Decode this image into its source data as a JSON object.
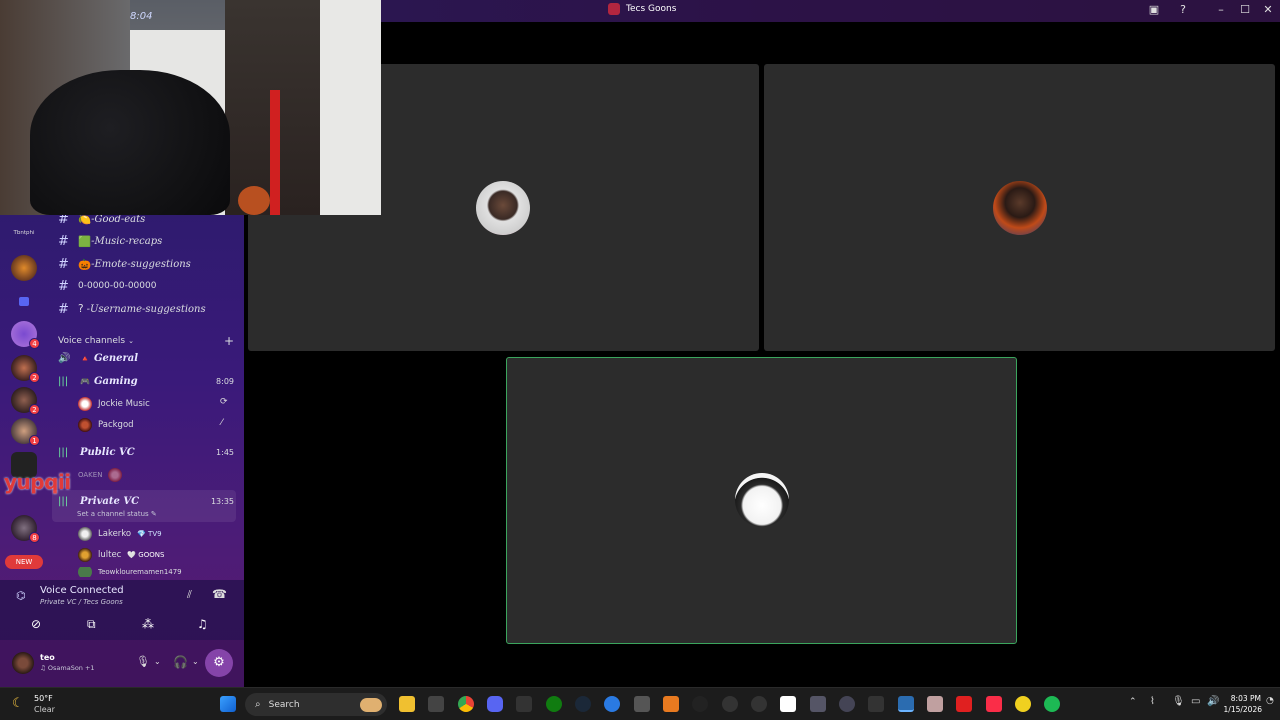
{
  "window": {
    "title": "Tecs Goons",
    "controls": {
      "minimize": "–",
      "maximize": "☐",
      "close": "✕"
    }
  },
  "webcam": {
    "clock_text": "8:04"
  },
  "server_rail": {
    "top_label": "Tbntphi",
    "badges": [
      "4",
      "2",
      "2",
      "1",
      "8"
    ],
    "promo_text": "yupqii",
    "new_badge": "NEW"
  },
  "text_channels": [
    {
      "emoji": "🍋",
      "name": "-Good-eats"
    },
    {
      "emoji": "🟩",
      "name": "-Music-recaps"
    },
    {
      "emoji": "🎃",
      "name": "-Emote-suggestions"
    },
    {
      "emoji": "",
      "name": "0-0000-00-00000"
    },
    {
      "emoji": "?",
      "name": "-Username-suggestions"
    }
  ],
  "voice_section": {
    "header": "Voice channels",
    "add": "+"
  },
  "voice_channels": [
    {
      "icon": "🔊",
      "emoji": "🔺",
      "name": "General",
      "time": ""
    },
    {
      "icon": "|||",
      "emoji": "🎮",
      "name": "Gaming",
      "time": "8:09"
    },
    {
      "icon": "|||",
      "emoji": "",
      "name": "Public VC",
      "time": "1:45"
    },
    {
      "icon": "|||",
      "emoji": "",
      "name": "Private VC",
      "time": "13:35",
      "status": "Set a channel status ✎"
    }
  ],
  "members": {
    "gaming": [
      {
        "name": "Jockie Music"
      },
      {
        "name": "Packgod"
      }
    ],
    "public": [
      {
        "name": "OAKEN"
      }
    ],
    "private": [
      {
        "name": "Lakerko",
        "tag": "💎 TV9"
      },
      {
        "name": "lultec",
        "tag": "🤍 GOONS"
      },
      {
        "name": "Teowklouremamen1479"
      }
    ]
  },
  "voice_panel": {
    "status": "Voice Connected",
    "channel": "Private VC / Tecs Goons"
  },
  "user_panel": {
    "username": "teo",
    "subtitle": "♫ OsamaSon +1"
  },
  "taskbar": {
    "weather_temp": "50°F",
    "weather_desc": "Clear",
    "search_placeholder": "Search",
    "time": "8:03 PM",
    "date": "1/15/2026"
  },
  "colors": {
    "accent_green": "#3ba55d",
    "tile_bg": "#2c2c2c",
    "sidebar_top": "#2f1b6f",
    "sidebar_bottom": "#5a1a6e"
  }
}
